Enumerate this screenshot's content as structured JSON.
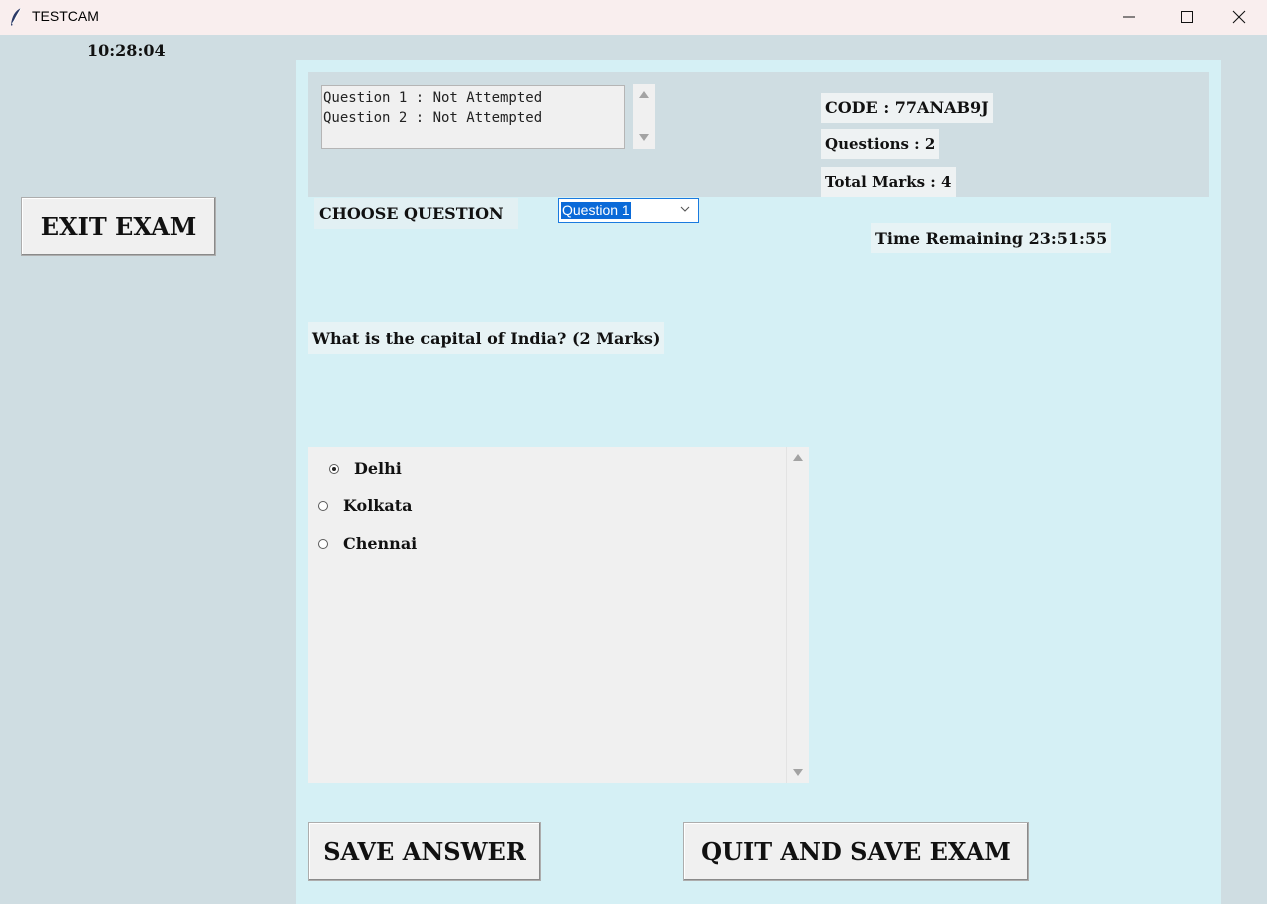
{
  "window": {
    "title": "TESTCAM",
    "icon": "feather-icon",
    "controls": [
      "minimize-icon",
      "maximize-icon",
      "close-icon"
    ]
  },
  "clock": "10:28:04",
  "sidebar": {
    "exit_label": "EXIT EXAM"
  },
  "status_list": {
    "items": [
      "Question 1 : Not Attempted",
      "Question 2 : Not Attempted"
    ]
  },
  "exam_info": {
    "code": "CODE : 77ANAB9J",
    "questions": "Questions : 2",
    "total_marks": "Total Marks : 4"
  },
  "chooser": {
    "label": "CHOOSE QUESTION",
    "selected": "Question 1"
  },
  "timer": "Time Remaining 23:51:55",
  "question": {
    "text": "What is the capital of India? (2 Marks)",
    "options": [
      "Delhi",
      "Kolkata",
      "Chennai"
    ],
    "selected": "Delhi"
  },
  "actions": {
    "save_label": "SAVE ANSWER",
    "quit_label": "QUIT AND SAVE EXAM"
  }
}
